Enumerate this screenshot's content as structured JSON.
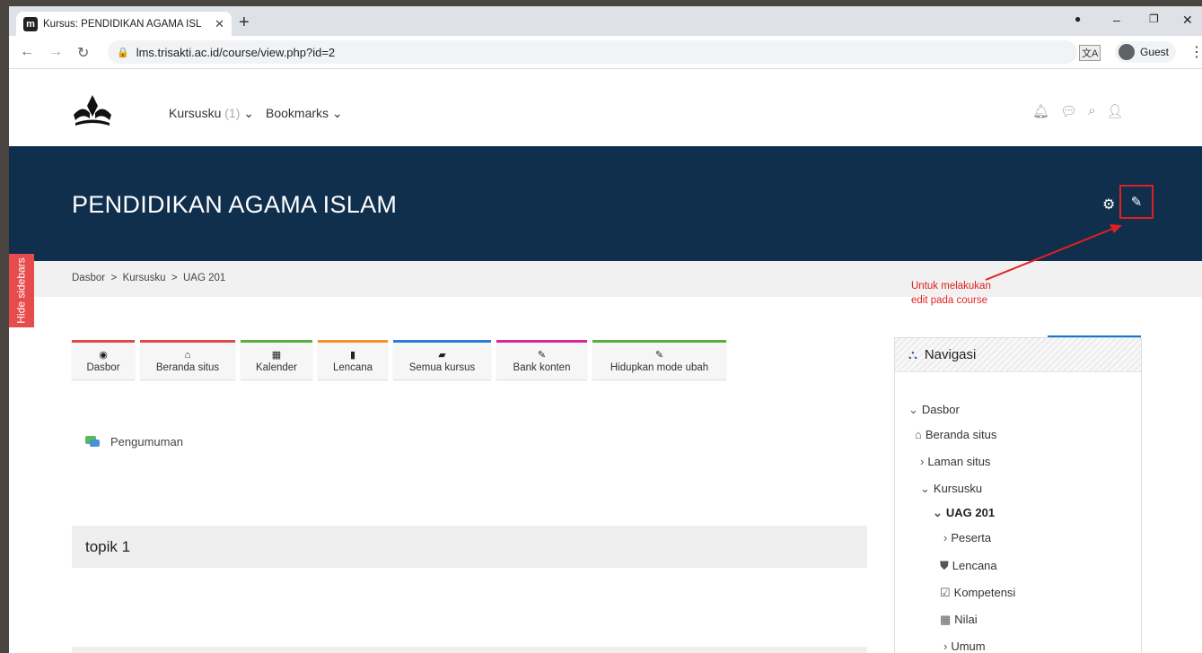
{
  "browser": {
    "tab_title": "Kursus: PENDIDIKAN AGAMA ISL",
    "favicon": "m",
    "url": "lms.trisakti.ac.id/course/view.php?id=2",
    "profile": "Guest"
  },
  "header": {
    "nav": [
      {
        "label": "Kursusku",
        "count": "(1)"
      },
      {
        "label": "Bookmarks"
      }
    ],
    "icons": [
      "bell-icon",
      "chat-icon",
      "search-icon",
      "user-icon"
    ]
  },
  "course": {
    "title": "PENDIDIKAN AGAMA ISLAM",
    "breadcrumb": "Dasbor  >  Kursusku  >  UAG 201"
  },
  "sidebar_toggle": "Hide sidebars",
  "annotation": {
    "line1": "Untuk melakukan",
    "line2": "edit pada course",
    "color": "#e02020"
  },
  "quick_buttons": [
    {
      "label": "Dasbor",
      "color": "#e04a4a"
    },
    {
      "label": "Beranda situs",
      "color": "#e04a4a"
    },
    {
      "label": "Kalender",
      "color": "#5aad3f"
    },
    {
      "label": "Lencana",
      "color": "#f0932b"
    },
    {
      "label": "Semua kursus",
      "color": "#2b7cd3"
    },
    {
      "label": "Bank konten",
      "color": "#d6279e"
    },
    {
      "label": "Hidupkan mode ubah",
      "color": "#5aad3f"
    }
  ],
  "content": {
    "announcement": "Pengumuman",
    "topic1": "topik 1"
  },
  "navigation": {
    "title": "Navigasi",
    "items": [
      {
        "label": "Dasbor"
      },
      {
        "label": "Beranda situs"
      },
      {
        "label": "Laman situs"
      },
      {
        "label": "Kursusku"
      },
      {
        "label": "UAG 201"
      },
      {
        "label": "Peserta"
      },
      {
        "label": "Lencana"
      },
      {
        "label": "Kompetensi"
      },
      {
        "label": "Nilai"
      },
      {
        "label": "Umum"
      }
    ]
  },
  "colors": {
    "banner": "#0f2f4d",
    "accent": "#1177d1",
    "sidebar_toggle": "#e74c4c"
  }
}
